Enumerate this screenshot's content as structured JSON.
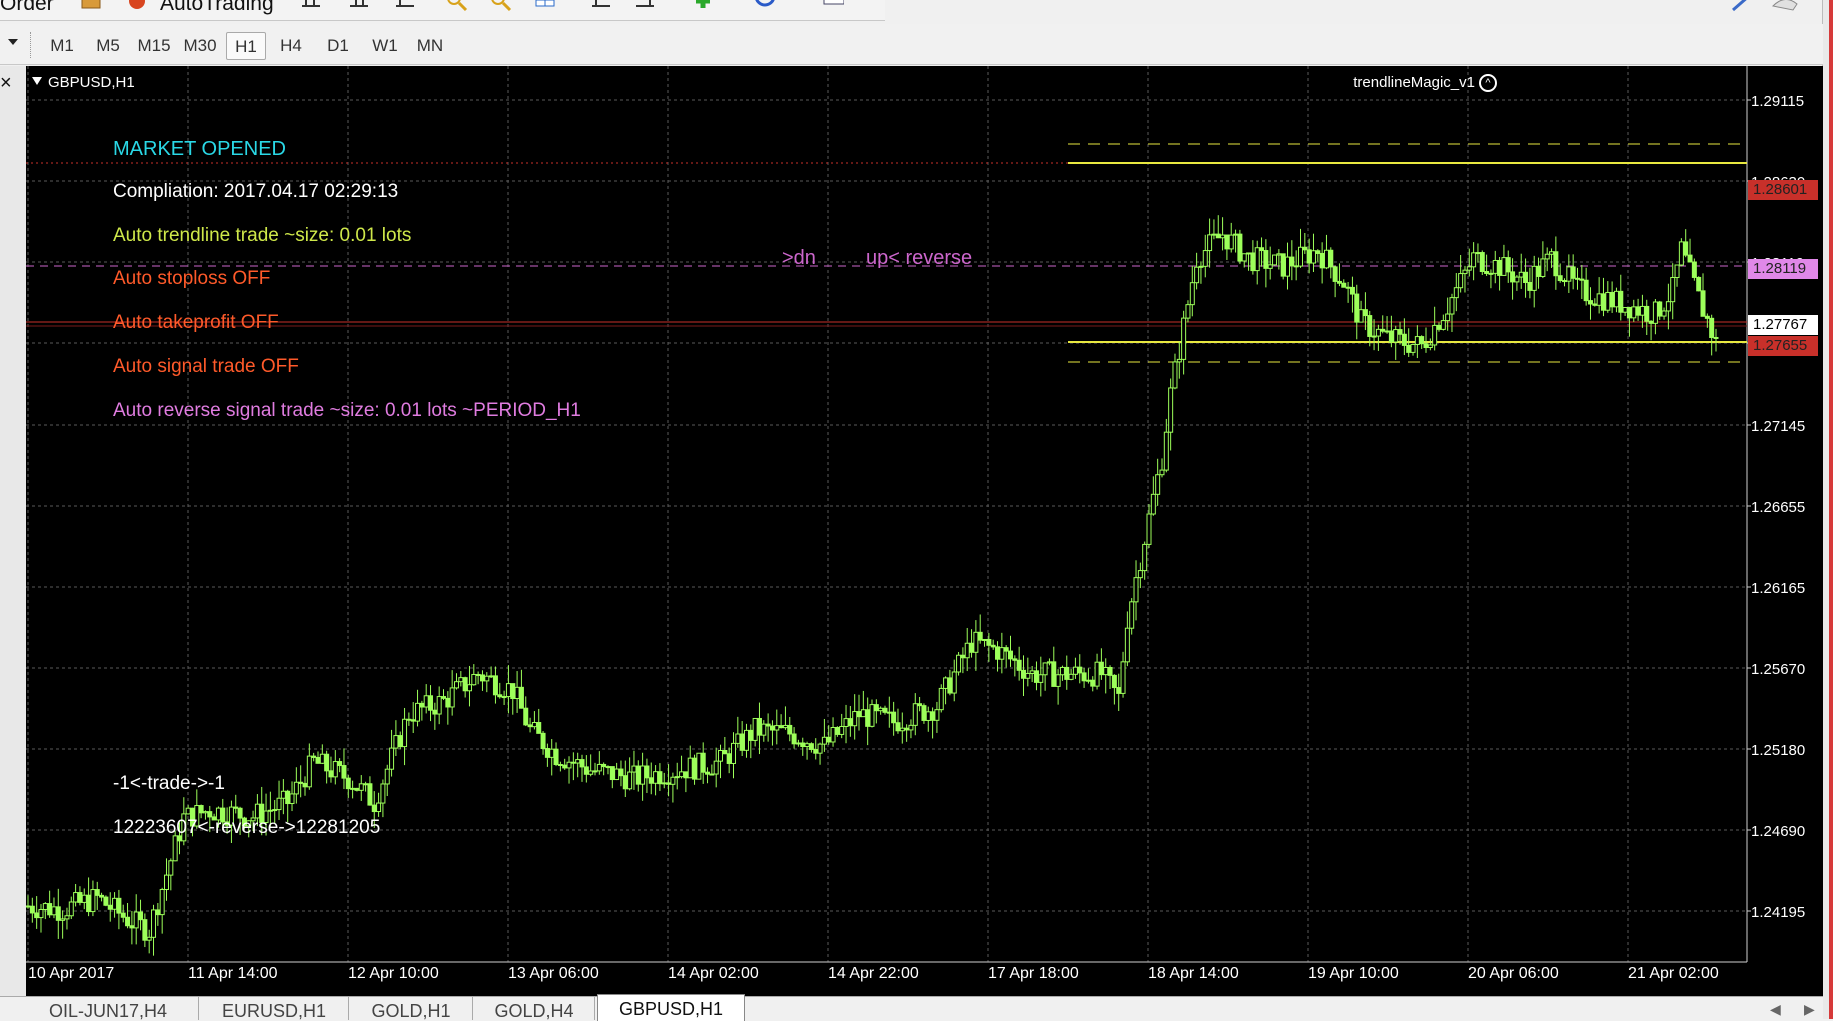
{
  "toolbar": {
    "order_label": "Order",
    "autotrading_label": "AutoTrading"
  },
  "timeframes": [
    "M1",
    "M5",
    "M15",
    "M30",
    "H1",
    "H4",
    "D1",
    "W1",
    "MN"
  ],
  "active_timeframe": "H1",
  "chart": {
    "symbol_label": "GBPUSD,H1",
    "indicator_label": "trendlineMagic_v1",
    "background": "#000000",
    "grid_color": "#5a5a5a",
    "bull_color": "#9dff5a",
    "bear_color": "#000000"
  },
  "info_text": {
    "market_status": "MARKET OPENED",
    "compilation": "Compliation: 2017.04.17 02:29:13",
    "auto_trendline": "Auto trendline trade ~size: 0.01 lots",
    "auto_stoploss": "Auto stoploss OFF",
    "auto_takeprofit": "Auto takeprofit OFF",
    "auto_signal": "Auto signal trade OFF",
    "auto_reverse": "Auto reverse signal trade ~size: 0.01 lots ~PERIOD_H1",
    "trade_counter": "-1<-trade->-1",
    "reverse_counter": "12223607<-reverse->12281205",
    "line_dn_label": ">dn",
    "line_up_label": "up< reverse"
  },
  "colors": {
    "market_status": "#2ad8e6",
    "compilation": "#ffffff",
    "auto_trendline": "#cfe84a",
    "off": "#ff5a2a",
    "auto_reverse": "#e07ce0",
    "counters": "#ffffff",
    "line_labels": "#cc66cc",
    "yellow_line": "#e8e840",
    "red_tag": "#c8302a",
    "pink_tag": "#e088e8"
  },
  "price_axis": [
    "1.29115",
    "1.28630",
    "1.28119",
    "1.27145",
    "1.26655",
    "1.26165",
    "1.25670",
    "1.25180",
    "1.24690",
    "1.24195"
  ],
  "price_tags": {
    "upper": "1.28601",
    "middle": "1.28119",
    "current": "1.27767",
    "lower": "1.27655"
  },
  "time_axis": [
    "10 Apr 2017",
    "11 Apr 14:00",
    "12 Apr 10:00",
    "13 Apr 06:00",
    "14 Apr 02:00",
    "14 Apr 22:00",
    "17 Apr 18:00",
    "18 Apr 14:00",
    "19 Apr 10:00",
    "20 Apr 06:00",
    "21 Apr 02:00"
  ],
  "tabs": [
    "OIL-JUN17,H4",
    "EURUSD,H1",
    "GOLD,H1",
    "GOLD,H4",
    "GBPUSD,H1"
  ],
  "active_tab": "GBPUSD,H1",
  "chart_data": {
    "type": "candlestick",
    "symbol": "GBPUSD",
    "timeframe": "H1",
    "ylim": [
      1.2385,
      1.2945
    ],
    "close_path": [
      [
        0,
        1.242
      ],
      [
        8,
        1.2418
      ],
      [
        16,
        1.2425
      ],
      [
        24,
        1.241
      ],
      [
        28,
        1.2405
      ],
      [
        32,
        1.244
      ],
      [
        36,
        1.2475
      ],
      [
        42,
        1.248
      ],
      [
        52,
        1.2476
      ],
      [
        60,
        1.2485
      ],
      [
        66,
        1.251
      ],
      [
        74,
        1.25
      ],
      [
        80,
        1.2485
      ],
      [
        88,
        1.254
      ],
      [
        96,
        1.2548
      ],
      [
        104,
        1.2565
      ],
      [
        112,
        1.2555
      ],
      [
        116,
        1.253
      ],
      [
        122,
        1.2515
      ],
      [
        130,
        1.2505
      ],
      [
        140,
        1.25
      ],
      [
        150,
        1.2505
      ],
      [
        160,
        1.251
      ],
      [
        168,
        1.253
      ],
      [
        176,
        1.2528
      ],
      [
        184,
        1.252
      ],
      [
        192,
        1.254
      ],
      [
        200,
        1.2535
      ],
      [
        210,
        1.2545
      ],
      [
        218,
        1.2585
      ],
      [
        224,
        1.258
      ],
      [
        232,
        1.2565
      ],
      [
        240,
        1.2565
      ],
      [
        248,
        1.2565
      ],
      [
        252,
        1.255
      ],
      [
        254,
        1.26
      ],
      [
        258,
        1.265
      ],
      [
        262,
        1.27
      ],
      [
        264,
        1.274
      ],
      [
        266,
        1.2768
      ],
      [
        270,
        1.2825
      ],
      [
        276,
        1.284
      ],
      [
        282,
        1.2825
      ],
      [
        290,
        1.282
      ],
      [
        298,
        1.283
      ],
      [
        304,
        1.281
      ],
      [
        308,
        1.2785
      ],
      [
        314,
        1.2775
      ],
      [
        322,
        1.277
      ],
      [
        328,
        1.2795
      ],
      [
        334,
        1.2825
      ],
      [
        340,
        1.282
      ],
      [
        346,
        1.281
      ],
      [
        352,
        1.2825
      ],
      [
        358,
        1.2805
      ],
      [
        364,
        1.28
      ],
      [
        370,
        1.2795
      ],
      [
        376,
        1.279
      ],
      [
        380,
        1.2805
      ],
      [
        382,
        1.283
      ],
      [
        386,
        1.28
      ],
      [
        390,
        1.2772
      ]
    ]
  }
}
